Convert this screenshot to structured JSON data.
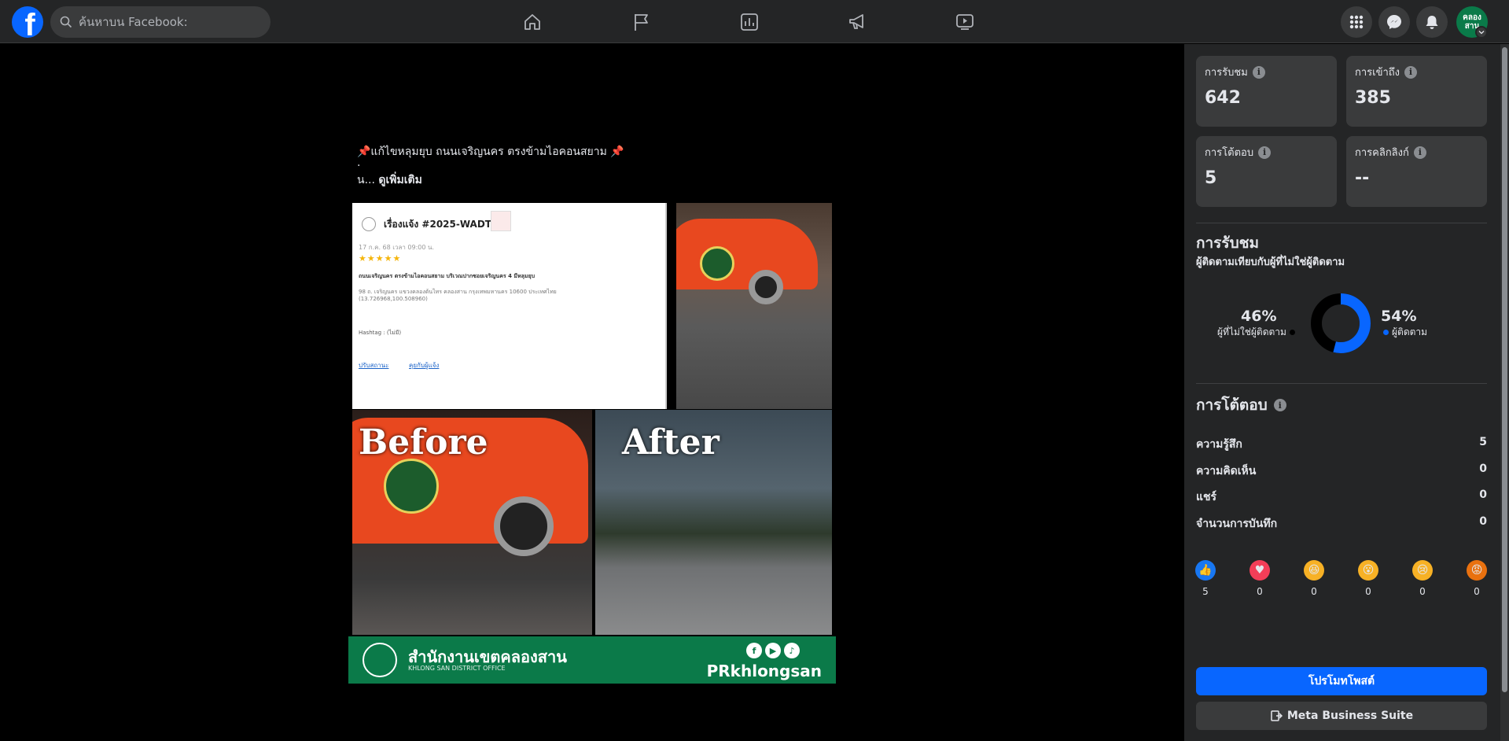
{
  "topbar": {
    "logo": "f",
    "search_placeholder": "ค้นหาบน Facebook:",
    "nav_icons": [
      "home-icon",
      "flag-icon",
      "insights-icon",
      "megaphone-icon",
      "video-icon"
    ],
    "avatar_text": "คลอง สาน"
  },
  "post": {
    "caption_line1": "📌แก้ไขหลุมยุบ ถนนเจริญนคร ตรงข้ามไอคอนสยาม 📌",
    "caption_dot": ".",
    "caption_prefix": "น... ",
    "see_more": "ดูเพิ่มเติม",
    "report": {
      "title": "เรื่องแจ้ง #2025-WADTYV",
      "date": "17 ก.ค. 68 เวลา 09:00 น.",
      "stars": "★★★★★",
      "desc": "ถนนเจริญนคร ตรงข้ามไอคอนสยาม บริเวณปากซอยเจริญนคร 4 มีหลุมยุบ",
      "address": "98 ถ. เจริญนคร แขวงคลองต้นไทร คลองสาน กรุงเทพมหานคร 10600 ประเทศไทย",
      "coords": "(13.726968,100.508960)",
      "hashtag": "Hashtag : (ไม่มี)",
      "link1": "ปรับสถานะ",
      "link2": "คุยกับผู้แจ้ง"
    },
    "before_label": "Before",
    "after_label": "After",
    "banner": {
      "title": "สำนักงานเขตคลองสาน",
      "subtitle": "KHLONG SAN DISTRICT OFFICE",
      "brand": "PRkhlongsan",
      "icons": [
        "f",
        "▶",
        "♪"
      ]
    }
  },
  "sidebar": {
    "stats": [
      {
        "label": "การรับชม",
        "value": "642"
      },
      {
        "label": "การเข้าถึง",
        "value": "385"
      },
      {
        "label": "การโต้ตอบ",
        "value": "5"
      },
      {
        "label": "การคลิกลิงก์",
        "value": "--"
      }
    ],
    "views_title": "การรับชม",
    "views_subtitle": "ผู้ติดตามเทียบกับผู้ที่ไม่ใช่ผู้ติดตาม",
    "non_followers_pct": "46%",
    "non_followers_label": "ผู้ที่ไม่ใช่ผู้ติดตาม",
    "followers_pct": "54%",
    "followers_label": "ผู้ติดตาม",
    "followers_fraction": 0.54,
    "engagement_title": "การโต้ตอบ",
    "engagement_rows": [
      {
        "label": "ความรู้สึก",
        "value": "5"
      },
      {
        "label": "ความคิดเห็น",
        "value": "0"
      },
      {
        "label": "แชร์",
        "value": "0"
      },
      {
        "label": "จำนวนการบันทึก",
        "value": "0"
      }
    ],
    "reactions": [
      {
        "icon": "like-icon",
        "glyph": "👍",
        "color": "#1877f2",
        "count": "5"
      },
      {
        "icon": "love-icon",
        "glyph": "♥",
        "color": "#f33e58",
        "count": "0"
      },
      {
        "icon": "haha-icon",
        "glyph": "😆",
        "color": "#f7b125",
        "count": "0"
      },
      {
        "icon": "wow-icon",
        "glyph": "😮",
        "color": "#f7b125",
        "count": "0"
      },
      {
        "icon": "sad-icon",
        "glyph": "😢",
        "color": "#f7b125",
        "count": "0"
      },
      {
        "icon": "angry-icon",
        "glyph": "😡",
        "color": "#e9710f",
        "count": "0"
      }
    ],
    "promote_label": "โปรโมทโพสต์",
    "meta_label": "Meta Business Suite"
  },
  "colors": {
    "accent": "#0866ff",
    "followers": "#0866ff",
    "non_followers": "#000000"
  }
}
